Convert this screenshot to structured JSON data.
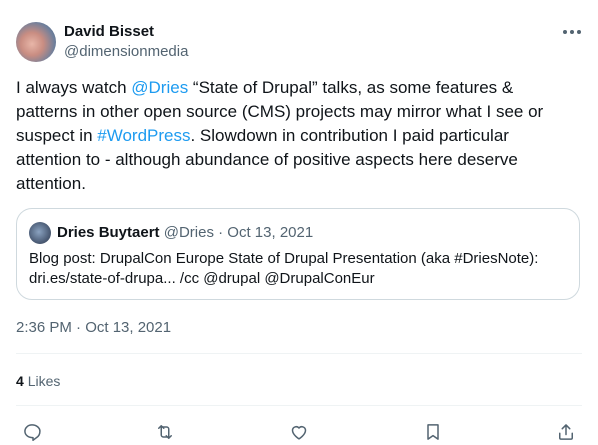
{
  "author": {
    "name": "David Bisset",
    "handle": "@dimensionmedia"
  },
  "tweet": {
    "parts": {
      "p1": "I always watch ",
      "mention": "@Dries",
      "p2": " “State of Drupal” talks, as some features & patterns in other open source (CMS) projects may mirror what I see or suspect in ",
      "hashtag": "#WordPress",
      "p3": ". Slowdown in contribution I paid particular attention to - although abundance of positive aspects here deserve attention."
    }
  },
  "quote": {
    "name": "Dries Buytaert",
    "handle": "@Dries",
    "separator": "·",
    "date": "Oct 13, 2021",
    "text": "Blog post: DrupalCon Europe State of Drupal Presentation (aka #DriesNote): dri.es/state-of-drupa... /cc @drupal @DrupalConEur"
  },
  "timestamp": "2:36 PM · Oct 13, 2021",
  "likes": {
    "count": "4",
    "label": "Likes"
  },
  "icons": {
    "more": "more-icon",
    "reply": "reply-icon",
    "retweet": "retweet-icon",
    "like": "like-icon",
    "bookmark": "bookmark-icon",
    "share": "share-icon"
  },
  "colors": {
    "link": "#1d9bf0",
    "secondary_text": "#536471",
    "border": "#cfd9de"
  }
}
